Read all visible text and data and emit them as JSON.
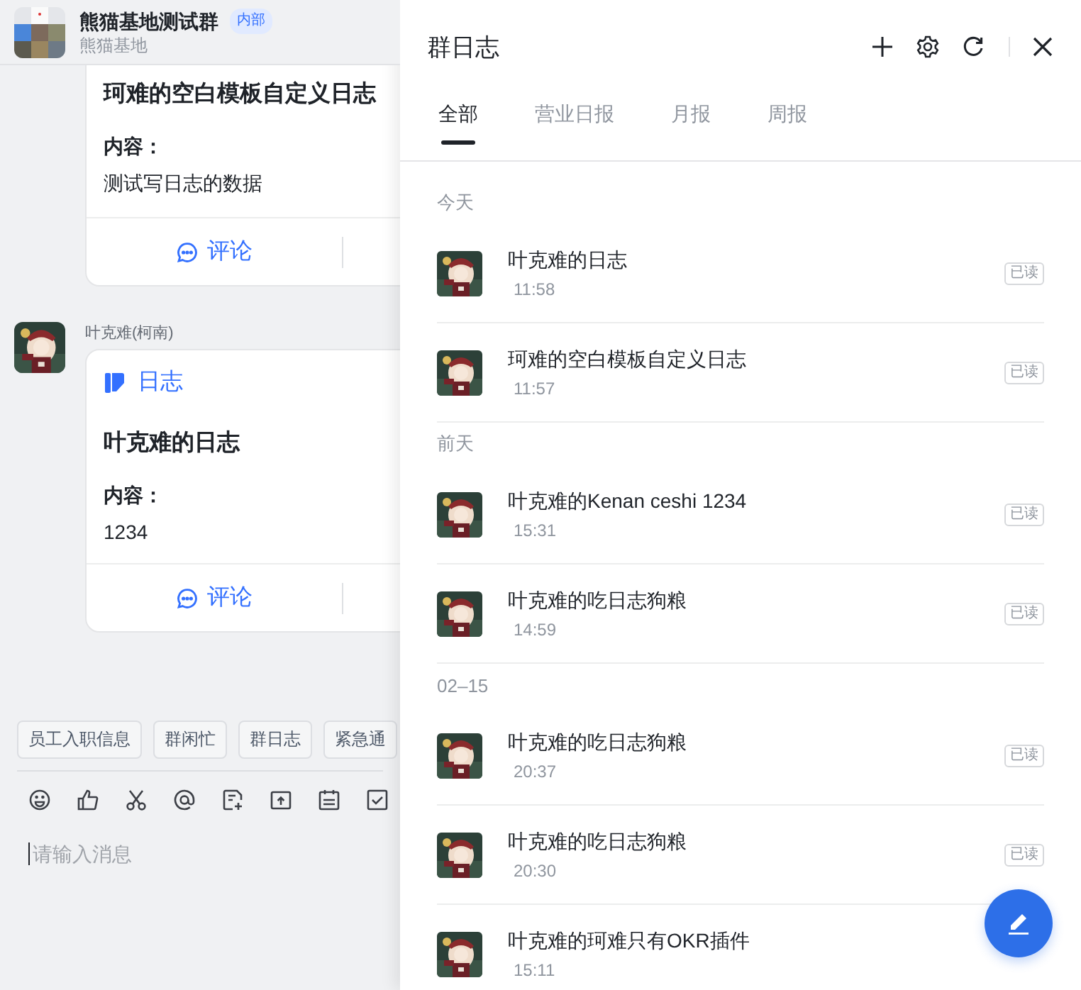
{
  "chat": {
    "group": {
      "name": "熊猫基地测试群",
      "badge": "内部",
      "subtitle": "熊猫基地"
    },
    "messages": [
      {
        "card": {
          "title": "珂难的空白模板自定义日志",
          "content_label": "内容：",
          "content": "测试写日志的数据",
          "action": "评论"
        }
      },
      {
        "sender": "叶克难(柯南)",
        "card": {
          "type_label": "日志",
          "title": "叶克难的日志",
          "content_label": "内容：",
          "content": "1234",
          "action": "评论"
        }
      }
    ],
    "quick_chips": [
      "员工入职信息",
      "群闲忙",
      "群日志",
      "紧急通"
    ],
    "input": {
      "placeholder": "请输入消息"
    }
  },
  "drawer": {
    "title": "群日志",
    "tabs": [
      {
        "label": "全部",
        "selected": true
      },
      {
        "label": "营业日报",
        "selected": false
      },
      {
        "label": "月报",
        "selected": false
      },
      {
        "label": "周报",
        "selected": false
      }
    ],
    "groups": [
      {
        "label": "今天",
        "items": [
          {
            "title": "叶克难的日志",
            "time": "11:58",
            "status": "已读"
          },
          {
            "title": "珂难的空白模板自定义日志",
            "time": "11:57",
            "status": "已读"
          }
        ]
      },
      {
        "label": "前天",
        "items": [
          {
            "title": "叶克难的Kenan ceshi 1234",
            "time": "15:31",
            "status": "已读"
          },
          {
            "title": "叶克难的吃日志狗粮",
            "time": "14:59",
            "status": "已读"
          }
        ]
      },
      {
        "label": "02–15",
        "items": [
          {
            "title": "叶克难的吃日志狗粮",
            "time": "20:37",
            "status": "已读"
          },
          {
            "title": "叶克难的吃日志狗粮",
            "time": "20:30",
            "status": "已读"
          },
          {
            "title": "叶克难的珂难只有OKR插件",
            "time": "15:11"
          }
        ]
      }
    ]
  }
}
